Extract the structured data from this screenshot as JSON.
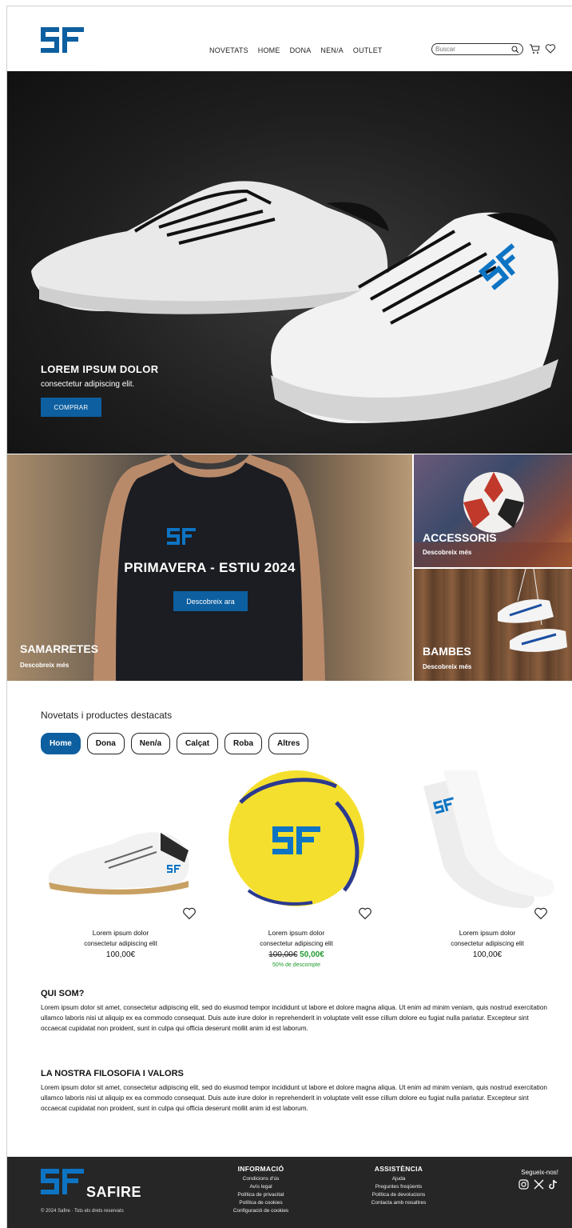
{
  "header": {
    "nav": [
      "NOVETATS",
      "HOME",
      "DONA",
      "NEN/A",
      "OUTLET"
    ],
    "search_placeholder": "Buscar"
  },
  "hero": {
    "title": "LOREM IPSUM DOLOR",
    "subtitle": "consectetur adipiscing elit.",
    "button": "COMPRAR"
  },
  "promo": {
    "center_title": "PRIMAVERA - ESTIU 2024",
    "center_button": "Descobreix ara",
    "shirts_label": "SAMARRETES",
    "shirts_link": "Descobreix més",
    "accessories_label": "ACCESSORIS",
    "accessories_link": "Descobreix més",
    "shoes_label": "BAMBES",
    "shoes_link": "Descobreix més"
  },
  "featured": {
    "title": "Novetats i productes destacats",
    "filters": [
      "Home",
      "Dona",
      "Nen/a",
      "Calçat",
      "Roba",
      "Altres"
    ],
    "active_filter": "Home",
    "products": [
      {
        "name": "Lorem ipsum dolor",
        "desc": "consectetur adipiscing elit",
        "price": "100,00€"
      },
      {
        "name": "Lorem ipsum dolor",
        "desc": "consectetur adipiscing elit",
        "old_price": "100,00€",
        "new_price": "50,00€",
        "discount": "50% de descompte"
      },
      {
        "name": "Lorem ipsum dolor",
        "desc": "consectetur adipiscing elit",
        "price": "100,00€"
      }
    ]
  },
  "about": {
    "title1": "QUI SOM?",
    "text1": "Lorem ipsum dolor sit amet, consectetur adipiscing elit, sed do eiusmod tempor incididunt ut labore et dolore magna aliqua. Ut enim ad minim veniam, quis nostrud exercitation ullamco laboris nisi ut aliquip ex ea commodo consequat. Duis aute irure dolor in reprehenderit in voluptate velit esse cillum dolore eu fugiat nulla pariatur. Excepteur sint occaecat cupidatat non proident, sunt in culpa qui officia deserunt mollit anim id est laborum.",
    "title2": "LA NOSTRA FILOSOFIA I VALORS",
    "text2": "Lorem ipsum dolor sit amet, consectetur adipiscing elit, sed do eiusmod tempor incididunt ut labore et dolore magna aliqua. Ut enim ad minim veniam, quis nostrud exercitation ullamco laboris nisi ut aliquip ex ea commodo consequat. Duis aute irure dolor in reprehenderit in voluptate velit esse cillum dolore eu fugiat nulla pariatur. Excepteur sint occaecat cupidatat non proident, sunt in culpa qui officia deserunt mollit anim id est laborum."
  },
  "footer": {
    "brand": "SAFIRE",
    "copyright": "© 2024 Safire · Tots els drets reservats",
    "info_title": "INFORMACIÓ",
    "info_links": [
      "Condicions d'ús",
      "Avís legal",
      "Política de privacitat",
      "Política de cookies",
      "Configuració de cookies"
    ],
    "help_title": "ASSISTÈNCIA",
    "help_links": [
      "Ajuda",
      "Preguntes freqüents",
      "Política de devolucions",
      "Contacta amb nosaltres"
    ],
    "social_title": "Segueix-nos!"
  },
  "colors": {
    "brand_blue": "#0d5fa0",
    "discount_green": "#1f9a2e",
    "footer_bg": "#262626"
  },
  "icons": [
    "sf-logo-icon",
    "search-icon",
    "cart-icon",
    "heart-icon",
    "instagram-icon",
    "x-icon",
    "tiktok-icon"
  ]
}
